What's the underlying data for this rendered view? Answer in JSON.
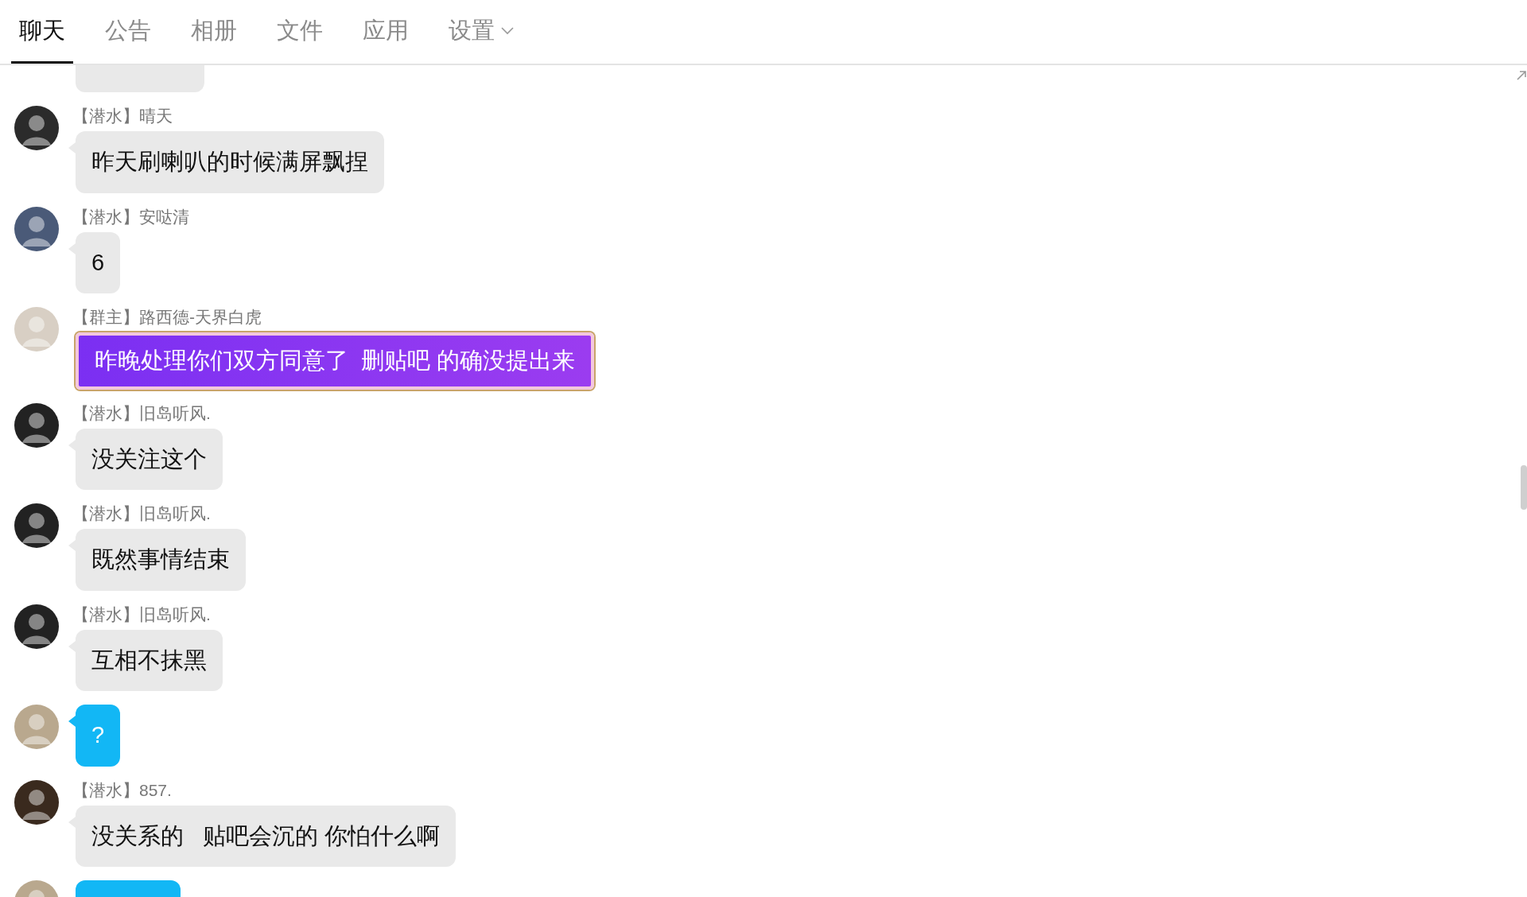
{
  "tabs": [
    {
      "label": "聊天",
      "selected": true
    },
    {
      "label": "公告",
      "selected": false
    },
    {
      "label": "相册",
      "selected": false
    },
    {
      "label": "文件",
      "selected": false
    },
    {
      "label": "应用",
      "selected": false
    },
    {
      "label": "设置",
      "selected": false,
      "dropdown": true
    }
  ],
  "messages": [
    {
      "kind": "normal",
      "tag": "【潜水】",
      "sender": "晴天",
      "text": "昨天刷喇叭的时候满屏飘捏"
    },
    {
      "kind": "normal",
      "tag": "【潜水】",
      "sender": "安哒清",
      "text": "6"
    },
    {
      "kind": "vip",
      "tag": "【群主】",
      "sender": "路西德-天界白虎",
      "text": "昨晚处理你们双方同意了  删贴吧 的确没提出来"
    },
    {
      "kind": "normal",
      "tag": "【潜水】",
      "sender": "旧岛听风.",
      "text": "没关注这个"
    },
    {
      "kind": "normal",
      "tag": "【潜水】",
      "sender": "旧岛听风.",
      "text": "既然事情结束"
    },
    {
      "kind": "normal",
      "tag": "【潜水】",
      "sender": "旧岛听风.",
      "text": "互相不抹黑"
    },
    {
      "kind": "blue",
      "text": "?"
    },
    {
      "kind": "normal",
      "tag": "【潜水】",
      "sender": "857.",
      "text": "没关系的   贴吧会沉的 你怕什么啊"
    }
  ]
}
